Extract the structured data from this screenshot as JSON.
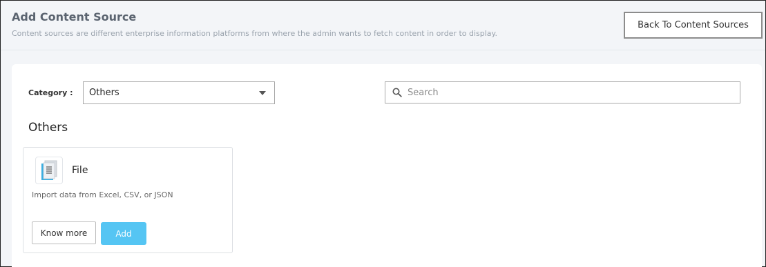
{
  "header": {
    "title": "Add Content Source",
    "subtitle": "Content sources are different enterprise information platforms from where the admin wants to fetch content in order to display.",
    "back_button_label": "Back To Content Sources"
  },
  "filters": {
    "category_label": "Category :",
    "category_selected": "Others",
    "search_placeholder": "Search"
  },
  "section": {
    "title": "Others",
    "cards": [
      {
        "icon": "file-document-icon",
        "title": "File",
        "description": "Import data from Excel, CSV, or JSON",
        "know_more_label": "Know more",
        "add_label": "Add"
      }
    ]
  },
  "colors": {
    "accent": "#55c5f3",
    "file_icon_blue": "#3aaee0"
  }
}
